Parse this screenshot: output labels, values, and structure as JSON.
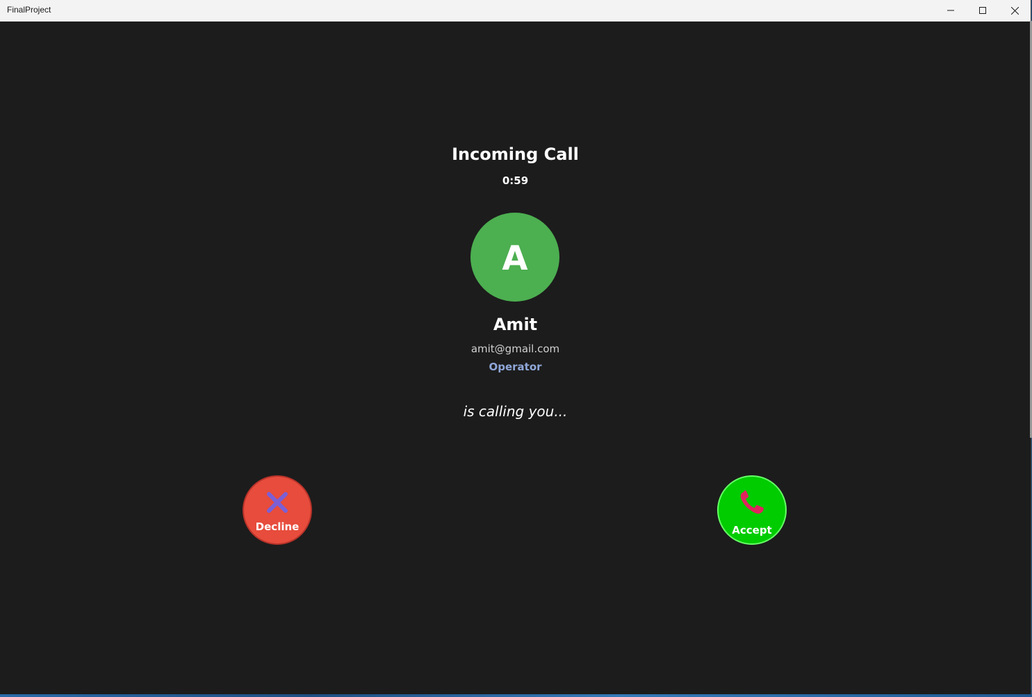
{
  "window": {
    "title": "FinalProject"
  },
  "call": {
    "title": "Incoming Call",
    "timer": "0:59",
    "calling_message": "is calling you..."
  },
  "caller": {
    "initial": "A",
    "name": "Amit",
    "email": "amit@gmail.com",
    "role": "Operator",
    "avatar_color": "#4caf50"
  },
  "actions": {
    "decline": {
      "label": "Decline",
      "icon": "close-x-icon",
      "color": "#e74c3c",
      "icon_color": "#7b5fd6"
    },
    "accept": {
      "label": "Accept",
      "icon": "phone-icon",
      "color": "#00cc00",
      "icon_color": "#e0245e"
    }
  }
}
